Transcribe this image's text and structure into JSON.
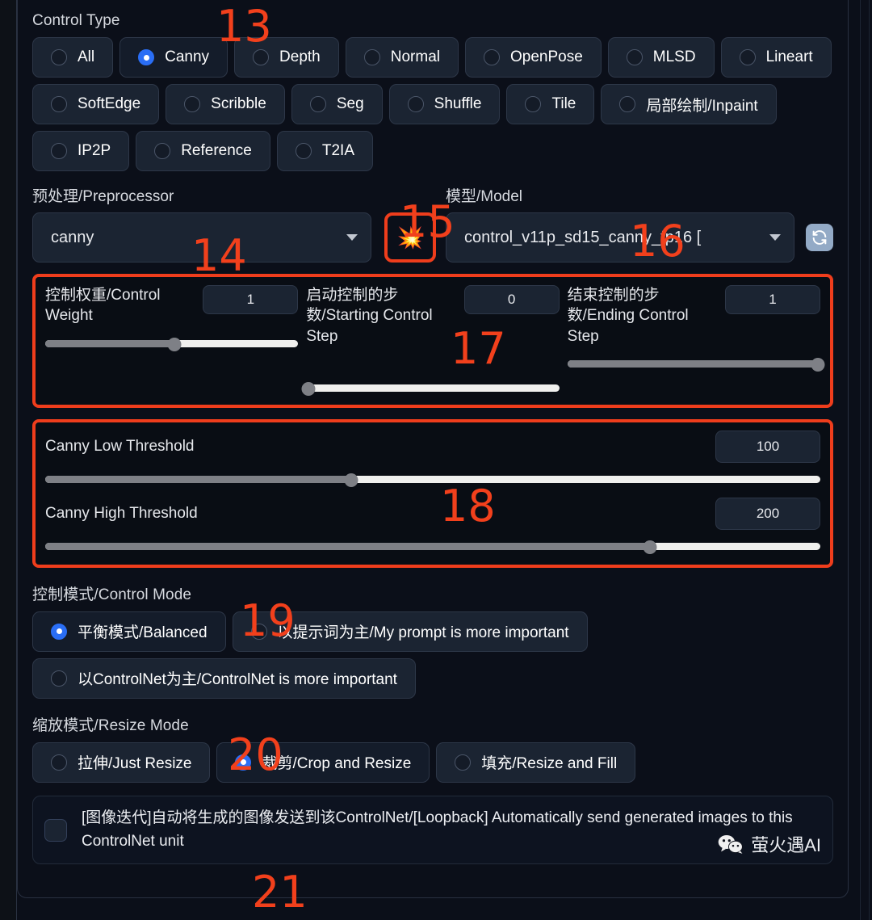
{
  "control_type": {
    "label": "Control Type",
    "options": [
      {
        "label": "All",
        "selected": false
      },
      {
        "label": "Canny",
        "selected": true
      },
      {
        "label": "Depth",
        "selected": false
      },
      {
        "label": "Normal",
        "selected": false
      },
      {
        "label": "OpenPose",
        "selected": false
      },
      {
        "label": "MLSD",
        "selected": false
      },
      {
        "label": "Lineart",
        "selected": false
      },
      {
        "label": "SoftEdge",
        "selected": false
      },
      {
        "label": "Scribble",
        "selected": false
      },
      {
        "label": "Seg",
        "selected": false
      },
      {
        "label": "Shuffle",
        "selected": false
      },
      {
        "label": "Tile",
        "selected": false
      },
      {
        "label": "局部绘制/Inpaint",
        "selected": false
      },
      {
        "label": "IP2P",
        "selected": false
      },
      {
        "label": "Reference",
        "selected": false
      },
      {
        "label": "T2IA",
        "selected": false
      }
    ]
  },
  "preprocessor": {
    "label": "预处理/Preprocessor",
    "value": "canny",
    "caret_icon": "chevron-down-icon"
  },
  "run_preprocessor": {
    "icon": "explosion-icon",
    "glyph": "💥"
  },
  "model": {
    "label": "模型/Model",
    "value": "control_v11p_sd15_canny_fp16 [",
    "caret_icon": "chevron-down-icon",
    "refresh_icon": "refresh-icon",
    "refresh_glyph": "🔄"
  },
  "weights": [
    {
      "label": "控制权重/Control Weight",
      "value": "1",
      "slider_percent": 51
    },
    {
      "label": "启动控制的步数/Starting Control Step",
      "value": "0",
      "slider_percent": 1
    },
    {
      "label": "结束控制的步数/Ending Control Step",
      "value": "1",
      "slider_percent": 99
    }
  ],
  "canny": [
    {
      "label": "Canny Low Threshold",
      "value": "100",
      "slider_percent": 39.5
    },
    {
      "label": "Canny High Threshold",
      "value": "200",
      "slider_percent": 78
    }
  ],
  "control_mode": {
    "label": "控制模式/Control Mode",
    "options": [
      {
        "label": "平衡模式/Balanced",
        "selected": true
      },
      {
        "label": "以提示词为主/My prompt is more important",
        "selected": false
      },
      {
        "label": "以ControlNet为主/ControlNet is more important",
        "selected": false
      }
    ]
  },
  "resize_mode": {
    "label": "缩放模式/Resize Mode",
    "options": [
      {
        "label": "拉伸/Just Resize",
        "selected": false
      },
      {
        "label": "裁剪/Crop and Resize",
        "selected": true
      },
      {
        "label": "填充/Resize and Fill",
        "selected": false
      }
    ]
  },
  "loopback": {
    "checked": false,
    "text": "[图像迭代]自动将生成的图像发送到该ControlNet/[Loopback] Automatically send generated images to this ControlNet unit"
  },
  "watermark": {
    "icon": "wechat-icon",
    "text": "萤火遇AI"
  },
  "annotations": {
    "a13": "13",
    "a14": "14",
    "a15": "15",
    "a16": "16",
    "a17": "17",
    "a18": "18",
    "a19": "19",
    "a20": "20",
    "a21": "21"
  },
  "colors": {
    "accent_blue": "#2a6ef5",
    "annotation_red": "#f2401c",
    "panel_bg": "#0b0f19",
    "pill_bg": "#1b2432"
  }
}
